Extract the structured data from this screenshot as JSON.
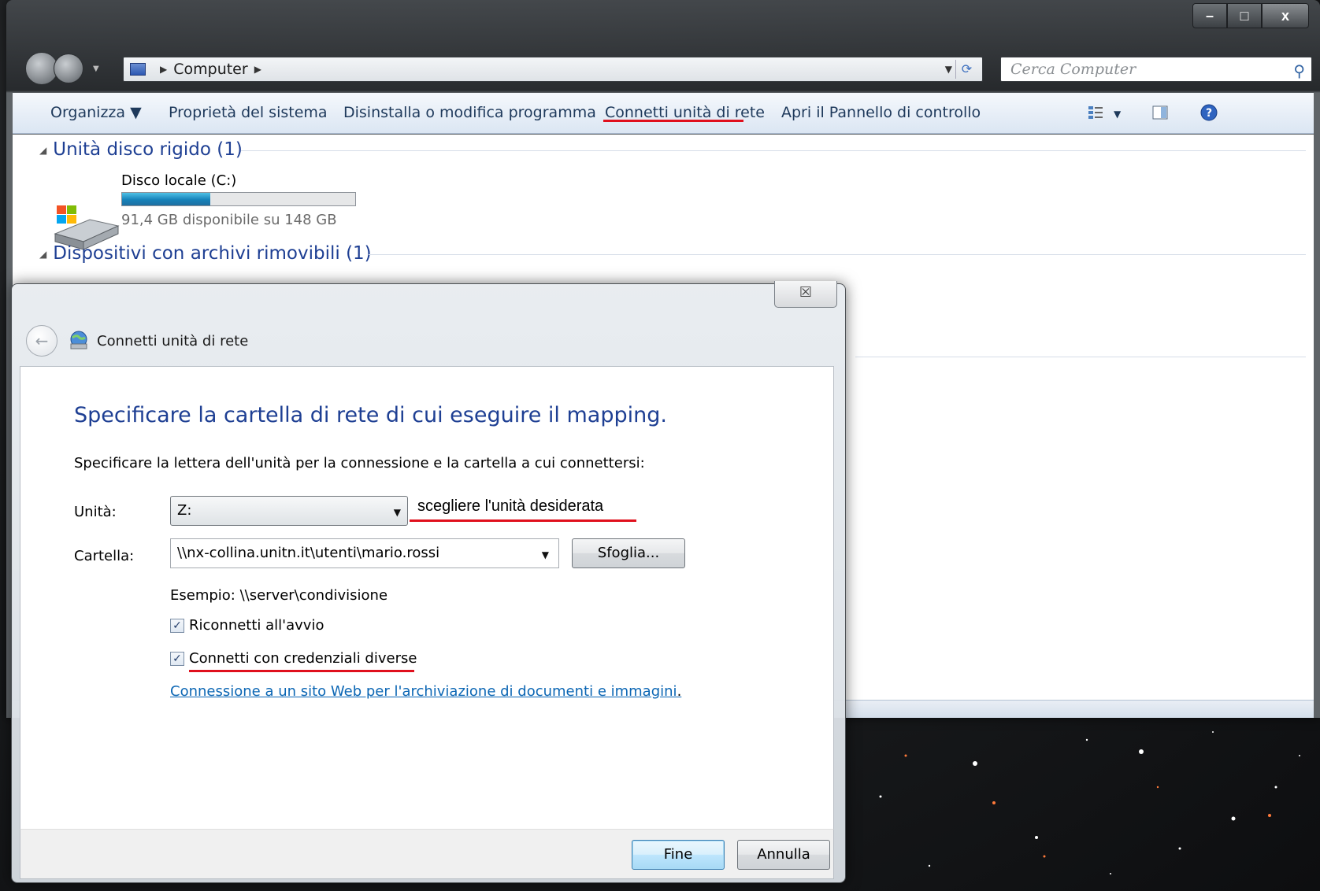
{
  "explorer": {
    "caption_buttons": {
      "minimize": "–",
      "maximize": "□",
      "close": "x"
    },
    "address": {
      "icon": "computer-icon",
      "crumb": "Computer"
    },
    "search": {
      "placeholder": "Cerca Computer",
      "icon": "search-icon"
    },
    "toolbar": {
      "organize": "Organizza ▼",
      "system_properties": "Proprietà del sistema",
      "uninstall": "Disinstalla o modifica programma",
      "map_network_drive": "Connetti unità di rete",
      "control_panel": "Apri il Pannello di controllo"
    },
    "groups": {
      "hard_disks": "Unità disco rigido (1)",
      "removable": "Dispositivi con archivi rimovibili (1)"
    },
    "drive": {
      "name": "Disco locale (C:)",
      "free_text": "91,4 GB disponibile su 148 GB",
      "used_fraction": 0.38
    }
  },
  "dialog": {
    "close": "☒",
    "title": "Connetti unità di rete",
    "heading": "Specificare la cartella di rete di cui eseguire il mapping.",
    "instruction": "Specificare la lettera dell'unità per la connessione e la cartella a cui connettersi:",
    "drive_label": "Unità:",
    "drive_value": "Z:",
    "drive_annotation": "scegliere l'unità desiderata",
    "folder_label": "Cartella:",
    "folder_value": "\\\\nx-collina.unitn.it\\utenti\\mario.rossi",
    "browse": "Sfoglia...",
    "example": "Esempio: \\\\server\\condivisione",
    "reconnect": {
      "label": "Riconnetti all'avvio",
      "checked": true
    },
    "other_credentials": {
      "label": "Connetti con credenziali diverse",
      "checked": true
    },
    "link": "Connessione a un sito Web per l'archiviazione di documenti e immagini",
    "finish": "Fine",
    "cancel": "Annulla"
  },
  "colors": {
    "accent_red": "#e0101d",
    "heading_blue": "#1e3f93",
    "link_blue": "#0b66b4"
  }
}
